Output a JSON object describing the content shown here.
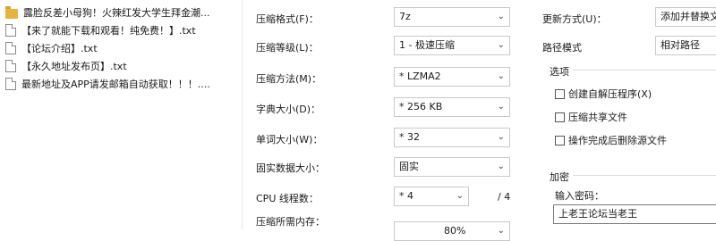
{
  "files": [
    {
      "name": "露脸反差小母狗！火辣红发大学生拜金潮...",
      "type": "folder"
    },
    {
      "name": "【来了就能下载和观看！纯免费！】.txt",
      "type": "doc"
    },
    {
      "name": "【论坛介绍】.txt",
      "type": "doc"
    },
    {
      "name": "【永久地址发布页】.txt",
      "type": "doc"
    },
    {
      "name": "最新地址及APP请发邮箱自动获取！！！....",
      "type": "doc"
    }
  ],
  "form": {
    "archive_format": {
      "label": "压缩格式(F)：",
      "value": "7z"
    },
    "compression_level": {
      "label": "压缩等级(L)：",
      "value": "1 - 极速压缩"
    },
    "compression_method": {
      "label": "压缩方法(M)：",
      "value": "* LZMA2"
    },
    "dictionary_size": {
      "label": "字典大小(D)：",
      "value": "* 256 KB"
    },
    "word_size": {
      "label": "单词大小(W)：",
      "value": "* 32"
    },
    "solid_block_size": {
      "label": "固实数据大小：",
      "value": "固实"
    },
    "cpu_threads": {
      "label": "CPU 线程数：",
      "value": "* 4",
      "total": "/ 4"
    },
    "memory_usage": {
      "label": "压缩所需内存：",
      "value": "80%"
    }
  },
  "right": {
    "update_mode": {
      "label": "更新方式(U)：",
      "value": "添加并替换文"
    },
    "path_mode": {
      "label": "路径模式",
      "value": "相对路径"
    },
    "options": {
      "title": "选项",
      "items": [
        {
          "label": "创建自解压程序(X)",
          "checked": false
        },
        {
          "label": "压缩共享文件",
          "checked": false
        },
        {
          "label": "操作完成后删除源文件",
          "checked": false
        }
      ]
    },
    "encryption": {
      "title": "加密",
      "password_label": "输入密码：",
      "password_value": "上老王论坛当老王"
    }
  },
  "icons": {
    "dropdown": "chevron-down-icon",
    "file": "text-file-icon",
    "folder": "folder-icon"
  }
}
